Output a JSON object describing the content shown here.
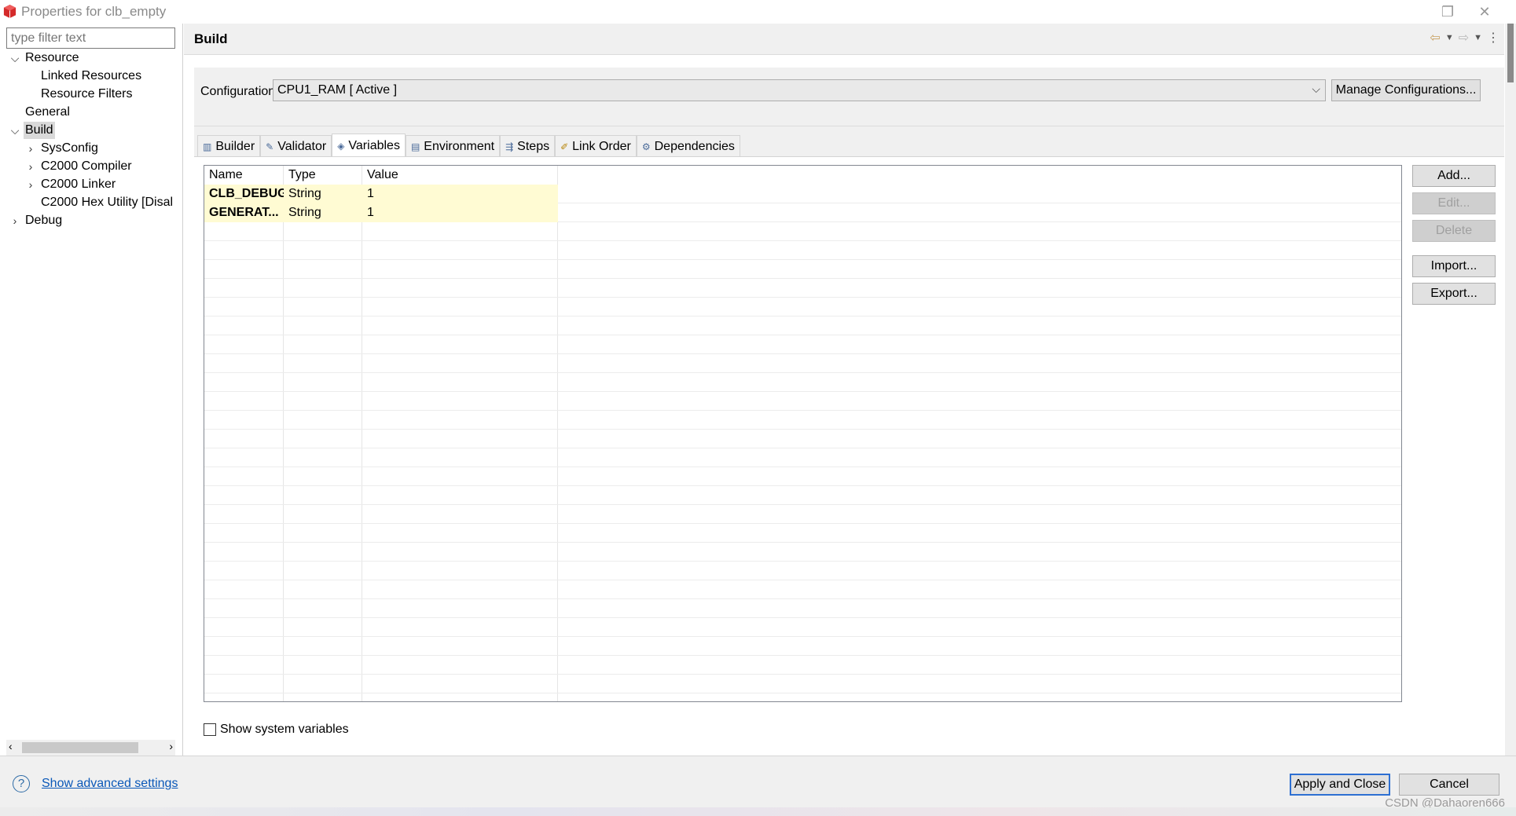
{
  "window": {
    "title": "Properties for clb_empty",
    "restore_glyph": "❐",
    "close_glyph": "✕"
  },
  "sidebar": {
    "filter_placeholder": "type filter text",
    "items": [
      {
        "label": "Resource",
        "expanded": true
      },
      {
        "label": "Linked Resources"
      },
      {
        "label": "Resource Filters"
      },
      {
        "label": "General"
      },
      {
        "label": "Build",
        "expanded": true,
        "selected": true
      },
      {
        "label": "SysConfig",
        "expanded": false
      },
      {
        "label": "C2000 Compiler",
        "expanded": false
      },
      {
        "label": "C2000 Linker",
        "expanded": false
      },
      {
        "label": "C2000 Hex Utility  [Disal"
      },
      {
        "label": "Debug",
        "expanded": false
      }
    ]
  },
  "page": {
    "title": "Build"
  },
  "configuration": {
    "label": "Configuration:",
    "value": "CPU1_RAM  [ Active ]",
    "manage_label": "Manage Configurations..."
  },
  "tabs": [
    {
      "label": "Builder",
      "icon": "builder-icon"
    },
    {
      "label": "Validator",
      "icon": "validator-icon"
    },
    {
      "label": "Variables",
      "icon": "variables-icon",
      "active": true
    },
    {
      "label": "Environment",
      "icon": "environment-icon"
    },
    {
      "label": "Steps",
      "icon": "steps-icon"
    },
    {
      "label": "Link Order",
      "icon": "link-order-icon"
    },
    {
      "label": "Dependencies",
      "icon": "dependencies-icon"
    }
  ],
  "variables_table": {
    "columns": [
      "Name",
      "Type",
      "Value"
    ],
    "rows": [
      {
        "name": "CLB_DEBUG",
        "type": "String",
        "value": "1"
      },
      {
        "name": "GENERAT...",
        "type": "String",
        "value": "1"
      }
    ]
  },
  "side_buttons": {
    "add": "Add...",
    "edit": "Edit...",
    "delete": "Delete",
    "import": "Import...",
    "export": "Export..."
  },
  "show_system_variables": {
    "label": "Show system variables",
    "checked": false
  },
  "footer": {
    "help_glyph": "?",
    "advanced_link": "Show advanced settings",
    "apply_close": "Apply and Close",
    "cancel": "Cancel",
    "watermark": "CSDN @Dahaoren666"
  },
  "colors": {
    "highlight_row": "#fffbd3",
    "link": "#0a58b8",
    "default_button_border": "#2d6fd2"
  }
}
